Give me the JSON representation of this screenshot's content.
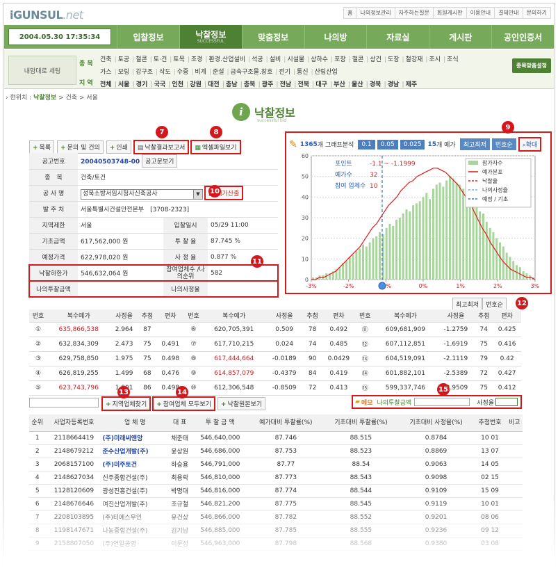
{
  "site": {
    "logo_main": "iGUNSUL",
    "logo_suffix": ".net"
  },
  "toplinks": [
    "홈",
    "나의정보관리",
    "자주하는질문",
    "회원게시판",
    "이용안내",
    "결제안내",
    "문의하기"
  ],
  "clock": "2004.05.30 17:35:34",
  "gnb": [
    {
      "label": "입찰정보"
    },
    {
      "label": "낙찰정보",
      "sub": "SUCCESSFUL"
    },
    {
      "label": "맞춤정보"
    },
    {
      "label": "나의방"
    },
    {
      "label": "자료실"
    },
    {
      "label": "게시판"
    },
    {
      "label": "공인인증서"
    }
  ],
  "mywin": "내맘대로 세팅",
  "subnav": {
    "sec1": "종 목",
    "sec2": "지 역",
    "row1": [
      "건축",
      "토공",
      "철콘",
      "토·건",
      "토목",
      "조경",
      "환경.산업설비",
      "석공",
      "설비",
      "시설물",
      "상하수",
      "포장",
      "철콘",
      "상건",
      "도장",
      "철강재",
      "조시",
      "조식"
    ],
    "row2": [
      "가스",
      "보링",
      "강구조",
      "삭도",
      "수중",
      "비계",
      "준설",
      "금속구조물.창호",
      "전기",
      "통신",
      "산림산업"
    ],
    "row3": [
      "전체",
      "서울",
      "경기",
      "국국",
      "인천",
      "강원",
      "대전",
      "충남",
      "충북",
      "광주",
      "전남",
      "전북",
      "대구",
      "부산",
      "울산",
      "경북",
      "경남",
      "제주"
    ],
    "tag": "종목맞춤설정"
  },
  "breadcrumb": {
    "prefix": "› 현위치 :",
    "current": "낙찰정보",
    "rest": "> 건축 > 서울"
  },
  "page_title": {
    "main": "낙찰정보",
    "sub": "successful bid"
  },
  "buttons": {
    "list": "목록",
    "inquiry": "문의 및 건의",
    "print": "인쇄",
    "report": "낙찰결과보고서",
    "excel": "엑셀파일보기"
  },
  "badges": [
    "7",
    "8",
    "9",
    "10",
    "11",
    "12",
    "13",
    "14",
    "15"
  ],
  "info": {
    "notice_no_label": "공고번호",
    "notice_no": "20040503748-00",
    "notice_btn": "공고문보기",
    "category_label": "종　목",
    "category": "건축/토건",
    "project_label": "공 사 명",
    "project": "성북소방서임시청사신축공사",
    "estimate_btn": "예가산출",
    "orderer_label": "발 주 처",
    "orderer": "서울특별시건설안전본부　[3708-2323]",
    "region_label": "지역제한",
    "region": "서울",
    "bid_date_label": "입찰일시",
    "bid_date": "05/29 11:00",
    "base_label": "기초금액",
    "base": "617,562,000 원",
    "rate_label": "투 찰 율",
    "rate": "87.745 %",
    "est_label": "예정가격",
    "est": "622,978,020 원",
    "assess_label": "사 정 율",
    "assess": "0.877 %",
    "lowest_label": "낙찰하한가",
    "lowest": "546,632,064 원",
    "count_label": "참여업체수 /나의순위",
    "count": "582",
    "mybid_label": "나의투찰금액",
    "mybid": "",
    "myassess_label": "나의사정율",
    "myassess": ""
  },
  "chart_bar": {
    "count": "1365",
    "count_suffix": "개 그래프분석",
    "b1": "0.1",
    "b2": "0.05",
    "b3": "0.025",
    "pred": "15",
    "pred_suffix": "개 예가",
    "high": "최고최저",
    "num": "번호순",
    "zoom": "확대"
  },
  "chart_data": {
    "type": "bar",
    "xlabel": "",
    "ylabel": "",
    "xlim": [
      -3,
      3
    ],
    "ylim": [
      0,
      60
    ],
    "x_ticks": [
      "-3%",
      "-2%",
      "-1%",
      "0%",
      "1%",
      "2%",
      "3%"
    ],
    "y_ticks": [
      "0",
      "10",
      "20",
      "30",
      "40",
      "50",
      "60"
    ],
    "annotations": {
      "point_label": "포인트",
      "point": "-1.1 ~ -1.1999",
      "pred_label": "예가수",
      "pred": "32",
      "join_label": "참여 업체수",
      "join": "10"
    },
    "legend": [
      "참가자수",
      "예가분포",
      "낙찰율",
      "나의사정율",
      "예정 / 기초"
    ],
    "legend_colors": [
      "#a6d69a",
      "#e01818",
      "#e01818",
      "#8aa6d8",
      "#3a70d0"
    ],
    "series": [
      {
        "name": "참가자수",
        "values": [
          1,
          1,
          2,
          2,
          3,
          3,
          4,
          5,
          6,
          8,
          9,
          11,
          12,
          14,
          15,
          17,
          16,
          18,
          20,
          21,
          23,
          22,
          25,
          27,
          26,
          29,
          30,
          32,
          34,
          33,
          36,
          37,
          38,
          40,
          42,
          39,
          44,
          46,
          47,
          45,
          48,
          50,
          49,
          47,
          46,
          44,
          42,
          40,
          38,
          36,
          33,
          32,
          28,
          25,
          23,
          20,
          18,
          16,
          13,
          11,
          9,
          7,
          6,
          4,
          3,
          2,
          1
        ]
      }
    ],
    "curve": [
      0,
      0,
      1,
      1,
      2,
      3,
      4,
      6,
      8,
      10,
      12,
      14,
      16,
      19,
      22,
      25,
      27,
      30,
      33,
      36,
      38,
      40,
      43,
      45,
      47,
      48,
      50,
      51,
      52,
      53,
      54,
      54,
      53,
      52,
      50,
      48,
      46,
      43,
      40,
      37,
      33,
      29,
      25,
      22,
      18,
      15,
      12,
      9,
      7,
      5,
      4,
      3,
      2,
      1,
      1,
      0
    ],
    "marker_x": -1.1
  },
  "sort_buttons": {
    "high": "최고최저",
    "num": "번호순"
  },
  "pred_table": {
    "headers": [
      "번호",
      "복수예가",
      "사정율",
      "추첨",
      "편차"
    ],
    "rows": [
      [
        [
          "①",
          "635,866,538",
          "2.964",
          "87",
          ""
        ],
        [
          "⑥",
          "620,705,391",
          "0.509",
          "78",
          "0.492"
        ],
        [
          "⑪",
          "609,681,909",
          "-1.2759",
          "74",
          "0.425"
        ]
      ],
      [
        [
          "②",
          "632,834,309",
          "2.473",
          "75",
          "0.491"
        ],
        [
          "⑦",
          "617,710,215",
          "0.024",
          "74",
          "0.485"
        ],
        [
          "⑫",
          "607,112,851",
          "-1.6919",
          "75",
          "0.416"
        ]
      ],
      [
        [
          "③",
          "629,758,850",
          "1.975",
          "75",
          "0.498"
        ],
        [
          "⑧",
          "617,444,664",
          "-0.0189",
          "90",
          "0.0429"
        ],
        [
          "⑬",
          "604,519,091",
          "-2.1119",
          "79",
          "0.42"
        ]
      ],
      [
        [
          "④",
          "626,819,255",
          "1.499",
          "68",
          "0.476"
        ],
        [
          "⑨",
          "614,857,079",
          "-0.4379",
          "84",
          "0.419"
        ],
        [
          "⑭",
          "601,882,101",
          "-2.5389",
          "72",
          "0.427"
        ]
      ],
      [
        [
          "⑤",
          "623,743,796",
          "1.001",
          "86",
          "0.498"
        ],
        [
          "⑩",
          "612,306,548",
          "-0.8509",
          "72",
          "0.413"
        ],
        [
          "⑮",
          "599,337,746",
          "-2.9509",
          "75",
          "0.412"
        ]
      ]
    ],
    "red": [
      [
        0,
        0
      ],
      [
        2,
        1
      ],
      [
        3,
        1
      ],
      [
        4,
        0
      ]
    ]
  },
  "tools": {
    "find": "지역업체찾기",
    "all": "참여업체 모두보기",
    "orig": "낙찰원본보기",
    "memo": "메모",
    "mybid": "나의투찰금액",
    "assess": "사정율"
  },
  "list": {
    "headers": [
      "순위",
      "사업자등록번호",
      "업 체 명",
      "대 표",
      "투 찰 금 액",
      "예가대비 투찰률(%)",
      "기초대비 투찰률(%)",
      "기초대비 사정율(%)",
      "추첨번호",
      "비고"
    ],
    "rows": [
      [
        "1",
        "2118664419",
        "(주)미래씨앤앙",
        "채준태",
        "546,640,000",
        "87.746",
        "88.515",
        "0.8784",
        "10 01",
        ""
      ],
      [
        "2",
        "2148679212",
        "준수산업개발(주)",
        "윤상원",
        "546,686,000",
        "87.753",
        "88.523",
        "0.8869",
        "13 07",
        ""
      ],
      [
        "3",
        "2068157100",
        "(주)미주토건",
        "하승용",
        "546,791,000",
        "87.77",
        "88.54",
        "0.9063",
        "14 05",
        ""
      ],
      [
        "4",
        "2148627034",
        "신주종합건설(주)",
        "최용락",
        "546,810,000",
        "87.773",
        "88.543",
        "0.9098",
        "02 15",
        ""
      ],
      [
        "5",
        "1128120609",
        "광성진흥건설(주)",
        "박명대",
        "546,816,000",
        "87.774",
        "88.544",
        "0.9109",
        "15 09",
        ""
      ],
      [
        "6",
        "2148676646",
        "여진산업개발(주)",
        "조규철",
        "546,821,200",
        "87.775",
        "88.545",
        "0.9119",
        "10 01",
        ""
      ],
      [
        "7",
        "2208103895",
        "(주)티에스우인",
        "유건상",
        "546,866,000",
        "87.782",
        "88.552",
        "0.9201",
        "08 06",
        ""
      ],
      [
        "8",
        "1198147671",
        "나농종합건설(주)",
        "김기남",
        "546,885,000",
        "87.785",
        "88.555",
        "0.9236",
        "09 12",
        ""
      ],
      [
        "9",
        "2158807050",
        "(주)연일공영",
        "이문성",
        "546,963,000",
        "87.798",
        "88.568",
        "0.9380",
        "03 08",
        ""
      ]
    ],
    "blue_rows": [
      0,
      1,
      2
    ]
  }
}
